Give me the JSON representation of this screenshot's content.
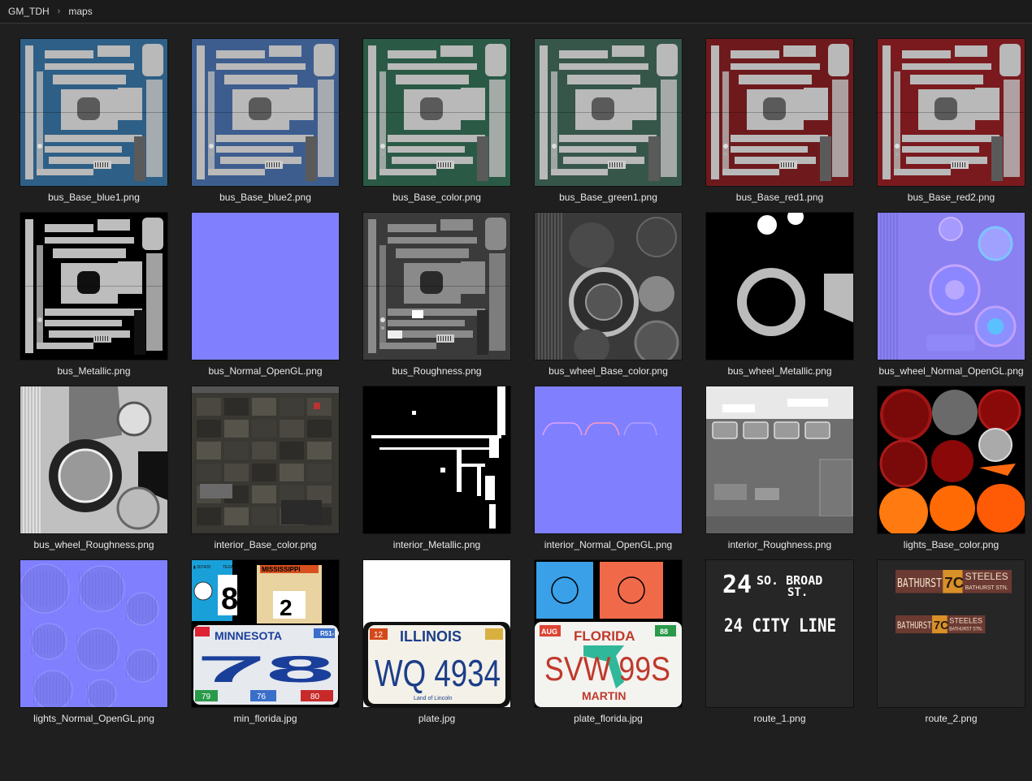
{
  "breadcrumb": {
    "root": "GM_TDH",
    "current": "maps"
  },
  "files": [
    {
      "name": "bus_Base_blue1.png",
      "kind": "bus",
      "color": "#2e5f86"
    },
    {
      "name": "bus_Base_blue2.png",
      "kind": "bus",
      "color": "#3d5d8f"
    },
    {
      "name": "bus_Base_color.png",
      "kind": "bus",
      "color": "#2a5a45"
    },
    {
      "name": "bus_Base_green1.png",
      "kind": "bus",
      "color": "#36564a"
    },
    {
      "name": "bus_Base_red1.png",
      "kind": "bus",
      "color": "#6e1a1d"
    },
    {
      "name": "bus_Base_red2.png",
      "kind": "bus",
      "color": "#7a1a1e"
    },
    {
      "name": "bus_Metallic.png",
      "kind": "metallic"
    },
    {
      "name": "bus_Normal_OpenGL.png",
      "kind": "normal"
    },
    {
      "name": "bus_Roughness.png",
      "kind": "roughness"
    },
    {
      "name": "bus_wheel_Base_color.png",
      "kind": "wheel"
    },
    {
      "name": "bus_wheel_Metallic.png",
      "kind": "wheelmetal"
    },
    {
      "name": "bus_wheel_Normal_OpenGL.png",
      "kind": "wheelnormal"
    },
    {
      "name": "bus_wheel_Roughness.png",
      "kind": "wheelrough"
    },
    {
      "name": "interior_Base_color.png",
      "kind": "interior"
    },
    {
      "name": "interior_Metallic.png",
      "kind": "intmetal"
    },
    {
      "name": "interior_Normal_OpenGL.png",
      "kind": "intnormal"
    },
    {
      "name": "interior_Roughness.png",
      "kind": "intrough"
    },
    {
      "name": "lights_Base_color.png",
      "kind": "lights"
    },
    {
      "name": "lights_Normal_OpenGL.png",
      "kind": "lightsnormal"
    },
    {
      "name": "min_florida.jpg",
      "kind": "minflorida",
      "texts": [
        "TEXAS",
        "MISSISSIPPI",
        "8",
        "2",
        "MINNESOTA",
        "R51-102",
        "78",
        "79",
        "76",
        "80"
      ]
    },
    {
      "name": "plate.jpg",
      "kind": "plate",
      "texts": [
        "ILLINOIS",
        "WQ 4934",
        "Land of Lincoln",
        "12"
      ]
    },
    {
      "name": "plate_florida.jpg",
      "kind": "plateflorida",
      "texts": [
        "FLORIDA",
        "SVW 99S",
        "MARTIN",
        "AUG",
        "88"
      ]
    },
    {
      "name": "route_1.png",
      "kind": "route1",
      "texts": [
        "24",
        "SO. BROAD",
        "ST.",
        "24 CITY LINE"
      ]
    },
    {
      "name": "route_2.png",
      "kind": "route2",
      "texts": [
        "BATHURST",
        "7C",
        "STEELES",
        "BATHURST STN."
      ]
    }
  ]
}
